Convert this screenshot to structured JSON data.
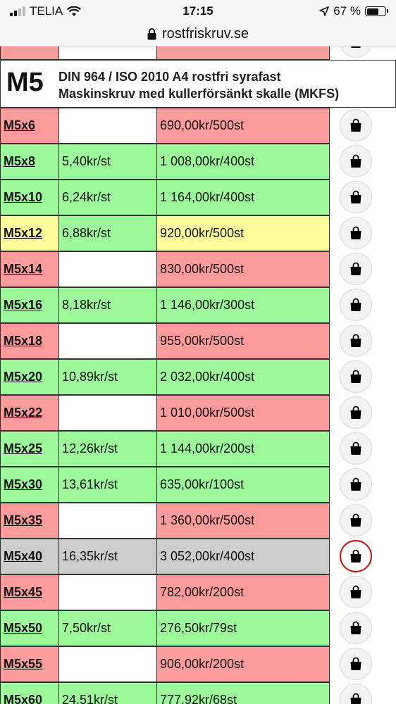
{
  "status_bar": {
    "carrier": "TELIA",
    "time": "17:15",
    "battery": "67 %",
    "battery_level": 0.67
  },
  "url_bar": {
    "domain": "rostfriskruv.se"
  },
  "section": {
    "code": "M5",
    "line1": "DIN 964 / ISO 2010 A4 rostfri syrafast",
    "line2": "Maskinskruv med kullerförsänkt skalle (MKFS)"
  },
  "cart_icon": "shopping-bag-icon",
  "colors": {
    "in_stock": "#9cfa9b",
    "out_of_stock": "#ff9b9b",
    "low_stock": "#ffff9c",
    "selected": "#cdcdcd"
  },
  "products": [
    {
      "name": "M5x6",
      "unit_price": "",
      "pack_price": "690,00kr/500st",
      "status": "red"
    },
    {
      "name": "M5x8",
      "unit_price": "5,40kr/st",
      "pack_price": "1 008,00kr/400st",
      "status": "green"
    },
    {
      "name": "M5x10",
      "unit_price": "6,24kr/st",
      "pack_price": "1 164,00kr/400st",
      "status": "green"
    },
    {
      "name": "M5x12",
      "unit_price": "6,88kr/st",
      "pack_price": "920,00kr/500st",
      "status": "yellow"
    },
    {
      "name": "M5x14",
      "unit_price": "",
      "pack_price": "830,00kr/500st",
      "status": "red"
    },
    {
      "name": "M5x16",
      "unit_price": "8,18kr/st",
      "pack_price": "1 146,00kr/300st",
      "status": "green"
    },
    {
      "name": "M5x18",
      "unit_price": "",
      "pack_price": "955,00kr/500st",
      "status": "red"
    },
    {
      "name": "M5x20",
      "unit_price": "10,89kr/st",
      "pack_price": "2 032,00kr/400st",
      "status": "green"
    },
    {
      "name": "M5x22",
      "unit_price": "",
      "pack_price": "1 010,00kr/500st",
      "status": "red"
    },
    {
      "name": "M5x25",
      "unit_price": "12,26kr/st",
      "pack_price": "1 144,00kr/200st",
      "status": "green"
    },
    {
      "name": "M5x30",
      "unit_price": "13,61kr/st",
      "pack_price": "635,00kr/100st",
      "status": "green"
    },
    {
      "name": "M5x35",
      "unit_price": "",
      "pack_price": "1 360,00kr/500st",
      "status": "red"
    },
    {
      "name": "M5x40",
      "unit_price": "16,35kr/st",
      "pack_price": "3 052,00kr/400st",
      "status": "grey",
      "selected": true
    },
    {
      "name": "M5x45",
      "unit_price": "",
      "pack_price": "782,00kr/200st",
      "status": "red"
    },
    {
      "name": "M5x50",
      "unit_price": "7,50kr/st",
      "pack_price": "276,50kr/79st",
      "status": "green"
    },
    {
      "name": "M5x55",
      "unit_price": "",
      "pack_price": "906,00kr/200st",
      "status": "red"
    },
    {
      "name": "M5x60",
      "unit_price": "24,51kr/st",
      "pack_price": "777,92kr/68st",
      "status": "green"
    }
  ]
}
